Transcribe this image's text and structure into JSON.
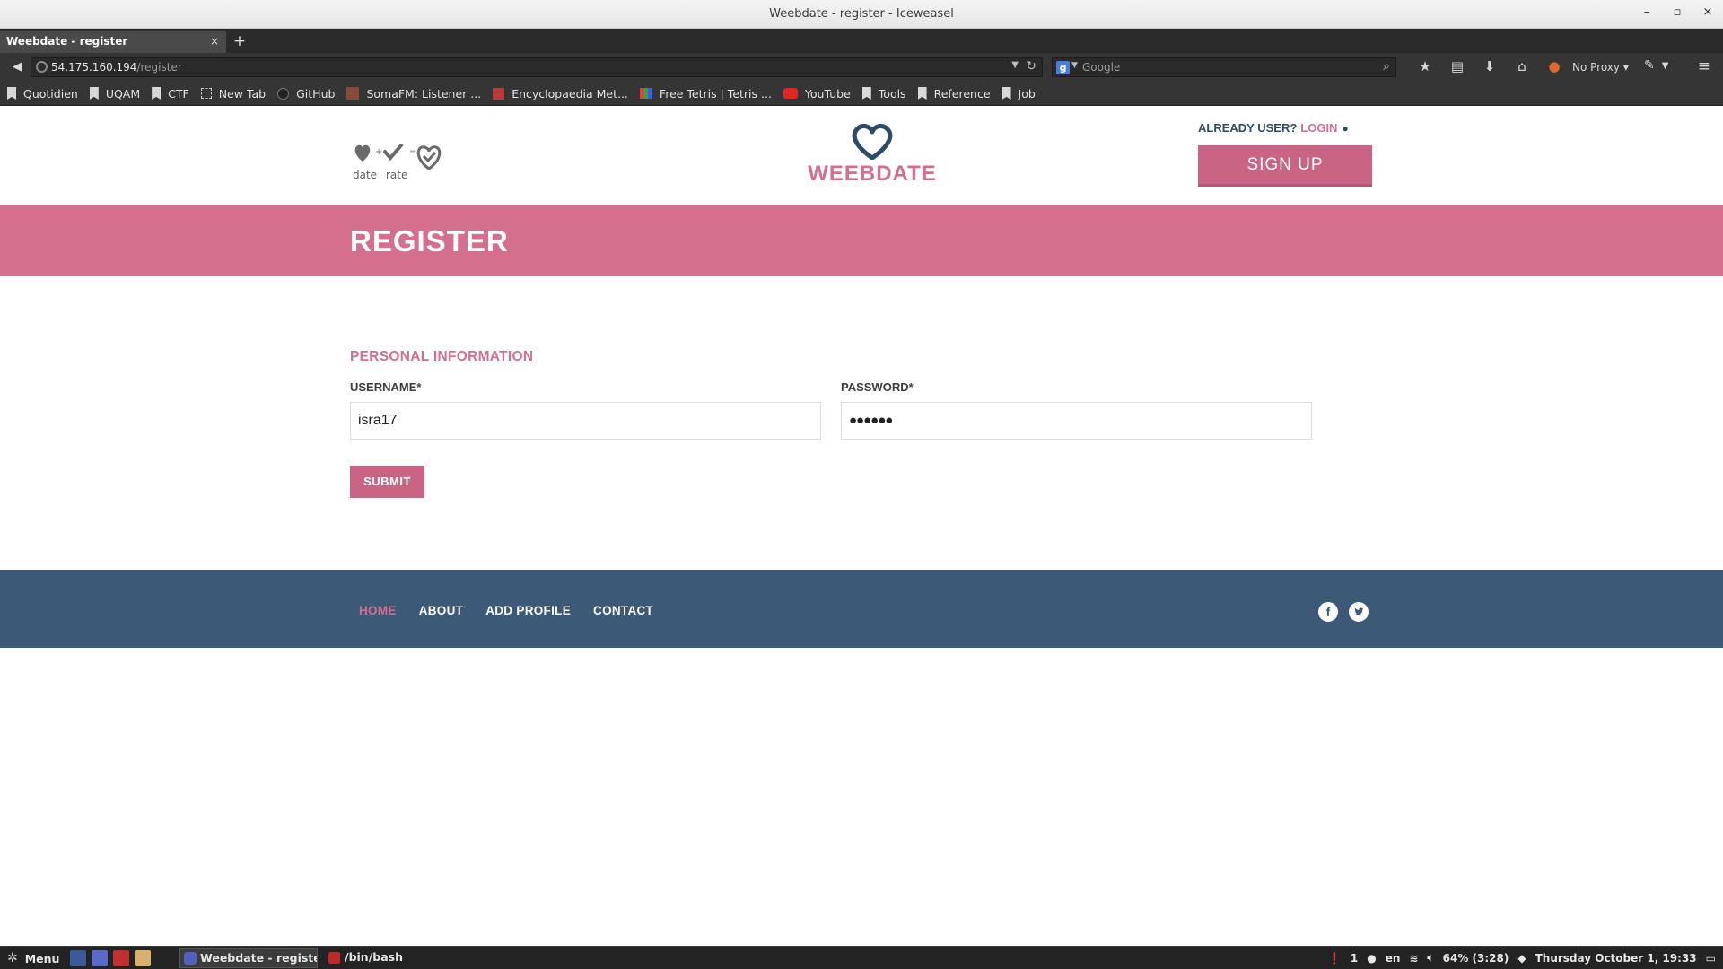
{
  "window": {
    "title": "Weebdate - register - Iceweasel",
    "controls": [
      "–",
      "▫",
      "×"
    ]
  },
  "tabs": [
    {
      "label": "Weebdate - register",
      "close": "×"
    }
  ],
  "new_tab": "+",
  "navbar": {
    "url_host": "54.175.160.194",
    "url_path": "/register",
    "search_placeholder": "Google",
    "proxy_label": "No Proxy ▾"
  },
  "bookmarks": [
    {
      "label": "Quotidien",
      "icon": "folder-icon"
    },
    {
      "label": "UQAM",
      "icon": "folder-icon"
    },
    {
      "label": "CTF",
      "icon": "folder-icon"
    },
    {
      "label": "New Tab",
      "icon": "blank-page-icon"
    },
    {
      "label": "GitHub",
      "icon": "github-icon"
    },
    {
      "label": "SomaFM: Listener ...",
      "icon": "somafm-icon"
    },
    {
      "label": "Encyclopaedia Met...",
      "icon": "encyclopaedia-icon"
    },
    {
      "label": "Free Tetris | Tetris ...",
      "icon": "tetris-icon"
    },
    {
      "label": "YouTube",
      "icon": "youtube-icon"
    },
    {
      "label": "Tools",
      "icon": "folder-icon"
    },
    {
      "label": "Reference",
      "icon": "folder-icon"
    },
    {
      "label": "Job",
      "icon": "folder-icon"
    }
  ],
  "header": {
    "mini_logo": {
      "date": "date",
      "rate": "rate",
      "plus": "+",
      "equals": "="
    },
    "brand": "WEEBDATE",
    "already_user": "ALREADY USER?",
    "login": "LOGIN",
    "signup": "SIGN UP"
  },
  "banner": {
    "title": "REGISTER"
  },
  "form": {
    "section_title": "PERSONAL INFORMATION",
    "username_label": "USERNAME*",
    "username_value": "isra17",
    "password_label": "PASSWORD*",
    "password_value": "●●●●●●",
    "submit": "SUBMIT"
  },
  "footer": {
    "nav": [
      "HOME",
      "ABOUT",
      "ADD PROFILE",
      "CONTACT"
    ],
    "active": "HOME",
    "facebook": "f",
    "twitter": "t"
  },
  "taskbar": {
    "menu": "Menu",
    "task1": "Weebdate - register ...",
    "task2": "/bin/bash",
    "tray": {
      "notif": "1",
      "lang": "en",
      "battery": "64% (3:28)",
      "clock": "Thursday October  1, 19:33"
    }
  },
  "colors": {
    "brand_pink": "#d46e8f",
    "banner_pink": "#d4708e",
    "navy": "#2d4a68",
    "footer_blue": "#3c5978"
  }
}
